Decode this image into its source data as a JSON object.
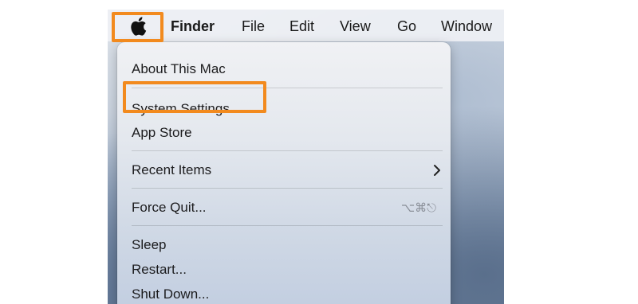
{
  "menubar": {
    "apple_icon": "apple-logo-icon",
    "items": [
      {
        "label": "Finder"
      },
      {
        "label": "File"
      },
      {
        "label": "Edit"
      },
      {
        "label": "View"
      },
      {
        "label": "Go"
      },
      {
        "label": "Window"
      }
    ]
  },
  "apple_menu": {
    "items": [
      {
        "label": "About This Mac"
      },
      {
        "label": "System Settings..."
      },
      {
        "label": "App Store"
      },
      {
        "label": "Recent Items",
        "submenu_icon": "chevron-right-icon"
      },
      {
        "label": "Force Quit...",
        "shortcut": "⌥⌘⎋"
      },
      {
        "label": "Sleep"
      },
      {
        "label": "Restart..."
      },
      {
        "label": "Shut Down..."
      }
    ]
  },
  "highlight_color": "#f28a1e"
}
